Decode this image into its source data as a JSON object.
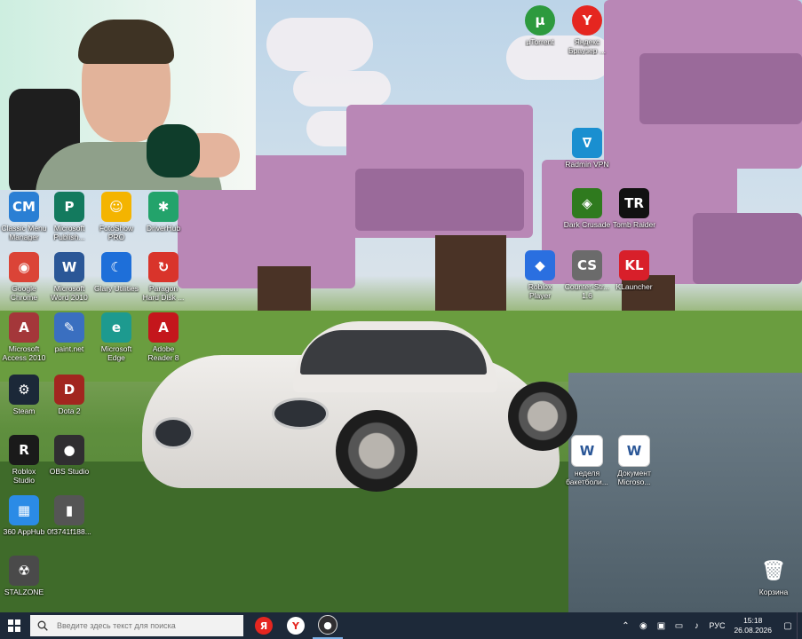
{
  "desktop": {
    "icons": [
      {
        "label": "Classic Menu\nManager",
        "glyph": "CM",
        "color": "#2a7fd4",
        "icon": "classic-menu-icon"
      },
      {
        "label": "Microsoft\nPublish...",
        "glyph": "P",
        "color": "#137a5e",
        "icon": "publisher-icon"
      },
      {
        "label": "FotoShow\nPRO",
        "glyph": "☺",
        "color": "#f4b400",
        "icon": "fotoshow-icon"
      },
      {
        "label": "DriverHub",
        "glyph": "✱",
        "color": "#23a36b",
        "icon": "driverhub-icon"
      },
      {
        "label": "Google\nChrome",
        "glyph": "◉",
        "color": "#db4437",
        "icon": "chrome-icon"
      },
      {
        "label": "Microsoft\nWord 2010",
        "glyph": "W",
        "color": "#2b5797",
        "icon": "word-icon"
      },
      {
        "label": "Glary Utilities",
        "glyph": "☾",
        "color": "#1e6fd9",
        "icon": "glary-utilities-icon"
      },
      {
        "label": "Paragon\nHard Disk ...",
        "glyph": "↻",
        "color": "#d9342b",
        "icon": "paragon-icon"
      },
      {
        "label": "Microsoft\nAccess 2010",
        "glyph": "A",
        "color": "#a4373a",
        "icon": "access-icon"
      },
      {
        "label": "paint.net",
        "glyph": "✎",
        "color": "#3a6fc0",
        "icon": "paintnet-icon"
      },
      {
        "label": "Microsoft\nEdge",
        "glyph": "e",
        "color": "#1d9a8f",
        "icon": "edge-icon"
      },
      {
        "label": "Adobe\nReader 8",
        "glyph": "A",
        "color": "#c4161c",
        "icon": "adobe-reader-icon"
      },
      {
        "label": "Steam",
        "glyph": "⚙",
        "color": "#1b2838",
        "icon": "steam-icon"
      },
      {
        "label": "Dota 2",
        "glyph": "D",
        "color": "#a2261f",
        "icon": "dota2-icon"
      },
      {
        "label": "Roblox\nStudio",
        "glyph": "R",
        "color": "#1a1a1a",
        "icon": "roblox-studio-icon"
      },
      {
        "label": "OBS Studio",
        "glyph": "●",
        "color": "#302e31",
        "icon": "obs-icon"
      },
      {
        "label": "360 AppHub",
        "glyph": "▦",
        "color": "#2b8be6",
        "icon": "apphub-icon"
      },
      {
        "label": "0f3741f188...",
        "glyph": "▮",
        "color": "#555555",
        "icon": "file-icon"
      },
      {
        "label": "STALZONE",
        "glyph": "☢",
        "color": "#4a4a4a",
        "icon": "stalzone-icon"
      },
      {
        "label": "µTorrent",
        "glyph": "µ",
        "color": "#2d9a3e",
        "icon": "utorrent-icon"
      },
      {
        "label": "Яндекс\nБраузер ...",
        "glyph": "Y",
        "color": "#e52620",
        "icon": "yandex-browser-icon"
      },
      {
        "label": "Radmin VPN",
        "glyph": "∇",
        "color": "#1a8fd0",
        "icon": "radmin-vpn-icon"
      },
      {
        "label": "Dark Crusade",
        "glyph": "◈",
        "color": "#2f7a1e",
        "icon": "dark-crusade-icon"
      },
      {
        "label": "Tomb Raider",
        "glyph": "TR",
        "color": "#111111",
        "icon": "tomb-raider-icon"
      },
      {
        "label": "Roblox\nPlayer",
        "glyph": "◆",
        "color": "#2a6fe0",
        "icon": "roblox-player-icon"
      },
      {
        "label": "Counter-Str...\n1.6",
        "glyph": "CS",
        "color": "#6b6b6b",
        "icon": "counter-strike-icon"
      },
      {
        "label": "KLauncher",
        "glyph": "KL",
        "color": "#d81f2a",
        "icon": "klauncher-icon"
      },
      {
        "label": "неделя\nбакетболи...",
        "glyph": "W",
        "color": "#2b5797",
        "icon": "word-doc-icon"
      },
      {
        "label": "Документ\nMicroso...",
        "glyph": "W",
        "color": "#2b5797",
        "icon": "word-doc-icon"
      },
      {
        "label": "Корзина",
        "glyph": "🗑",
        "color": "#7a8c99",
        "icon": "recycle-bin-icon"
      }
    ]
  },
  "taskbar": {
    "search_placeholder": "Введите здесь текст для поиска",
    "apps": [
      {
        "name": "yandex-taskbar-app",
        "glyph": "Я",
        "color": "#e52620"
      },
      {
        "name": "yandex-browser-taskbar-app",
        "glyph": "Y",
        "color": "#e52620"
      },
      {
        "name": "obs-taskbar-app",
        "glyph": "●",
        "color": "#302e31"
      }
    ],
    "lang": "РУС",
    "time": "15:18",
    "date": "26.08.2026"
  }
}
